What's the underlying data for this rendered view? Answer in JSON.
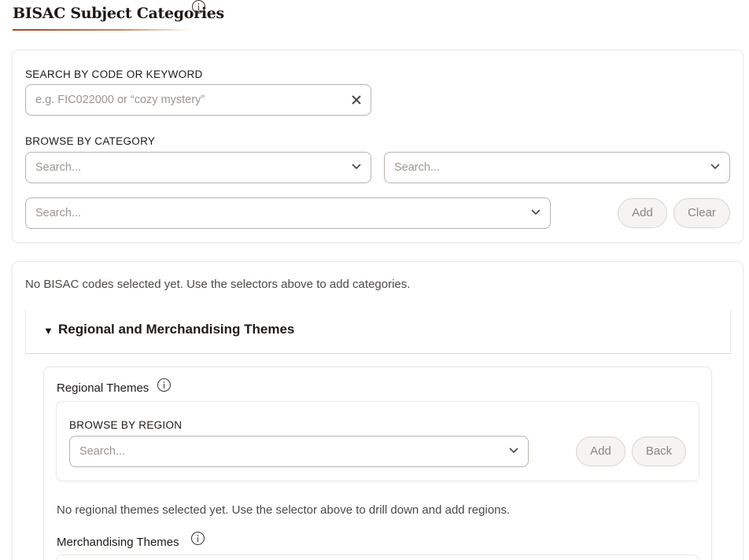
{
  "header": {
    "title": "BISAC Subject Categories",
    "info_icon": "info-icon"
  },
  "search": {
    "label": "SEARCH BY CODE OR KEYWORD",
    "placeholder": "e.g. FIC022000 or “cozy mystery”",
    "value": ""
  },
  "browse": {
    "label": "BROWSE BY CATEGORY",
    "select1_placeholder": "Search...",
    "select2_placeholder": "Search...",
    "select3_placeholder": "Search...",
    "add_label": "Add",
    "clear_label": "Clear"
  },
  "selected": {
    "empty_message": "No BISAC codes selected yet. Use the selectors above to add categories."
  },
  "themes": {
    "section_title": "Regional and Merchandising Themes",
    "expanded_marker": "▼",
    "regional": {
      "label": "Regional Themes",
      "browse_label": "BROWSE BY REGION",
      "select_placeholder": "Search...",
      "add_label": "Add",
      "back_label": "Back",
      "empty_message": "No regional themes selected yet. Use the selector above to drill down and add regions."
    },
    "merchandising": {
      "label": "Merchandising Themes"
    }
  },
  "colors": {
    "accent_underline": "#9a4a1c",
    "border": "#b9b3ae",
    "placeholder": "#9b9590",
    "disabled_button_bg": "#f6f4f2"
  }
}
